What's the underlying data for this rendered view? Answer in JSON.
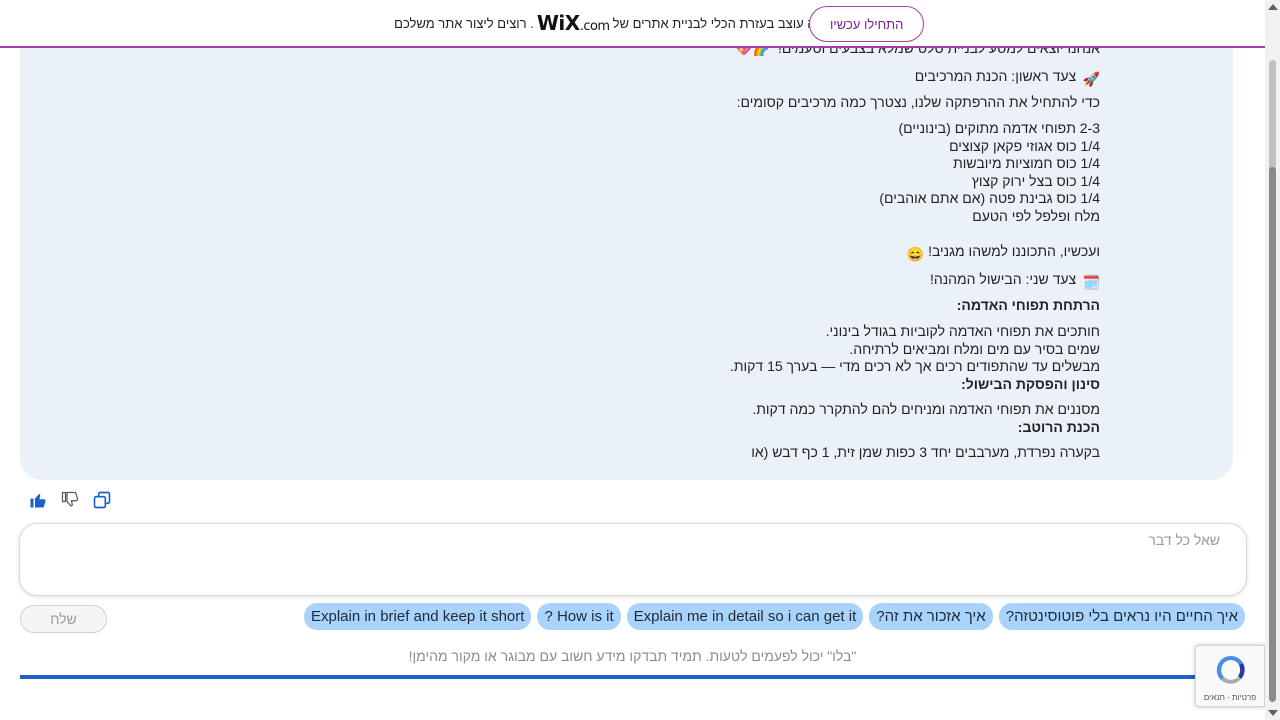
{
  "banner": {
    "cta_label": "התחילו עכשיו",
    "text_before_logo": "?האתר הזה עוצב בעזרת הכלי לבניית אתרים של",
    "logo_text": "WiX",
    "logo_suffix": ".com",
    "text_after_logo": ". רוצים ליצור אתר משלכם"
  },
  "message": {
    "clipped_line": "אנחנו יוצאים למסע לבניית סלט שמלא בצבעים וטעמים!",
    "step1_title": "צעד ראשון: הכנת המרכיבים",
    "intro": "כדי להתחיל את ההרפתקה שלנו, נצטרך כמה מרכיבים קסומים:",
    "ingredients": [
      "2-3 תפוחי אדמה מתוקים (בינוניים)",
      "1/4 כוס אגוזי פקאן קצוצים",
      "1/4 כוס חמוציות מיובשות",
      "1/4 כוס בצל ירוק קצוץ",
      "1/4 כוס גבינת פטה (אם אתם אוהבים)",
      "מלח ופלפל לפי הטעם"
    ],
    "ready": "ועכשיו, התכוננו למשהו מגניב!",
    "step2_title": "צעד שני: הבישול המהנה!",
    "boil_title": "הרתחת תפוחי האדמה:",
    "boil_lines": [
      "חותכים את תפוחי האדמה לקוביות בגודל בינוני.",
      "שמים בסיר עם מים ומלח ומביאים לרתיחה.",
      "מבשלים עד שהתפודים רכים אך לא רכים מדי — בערך 15 דקות."
    ],
    "strain_title": "סינון והפסקת הבישול:",
    "strain_line": "מסננים את תפוחי האדמה ומניחים להם להתקרר כמה דקות.",
    "dressing_title": "הכנת הרוטב:",
    "dressing_line": "בקערה נפרדת, מערבבים יחד 3 כפות שמן זית, 1 כף דבש (או"
  },
  "feedback": {
    "icons": [
      "thumbs-up-icon",
      "thumbs-down-icon",
      "copy-icon"
    ],
    "accent": "#1a62c9"
  },
  "composer": {
    "placeholder": "שאל כל דבר",
    "send_label": "שלח"
  },
  "suggestions": [
    "?איך החיים היו נראים בלי פוטוסינטזה",
    "?איך אזכור את זה",
    "Explain me in detail so i can get it",
    "? How is it",
    "Explain in brief and keep it short"
  ],
  "disclaimer": "\"בלו\" יכול לפעמים לטעות. תמיד תבדקו מידע חשוב עם מבוגר או מקור מהימן!",
  "recaptcha": {
    "links": "פרטיות - תנאים"
  }
}
